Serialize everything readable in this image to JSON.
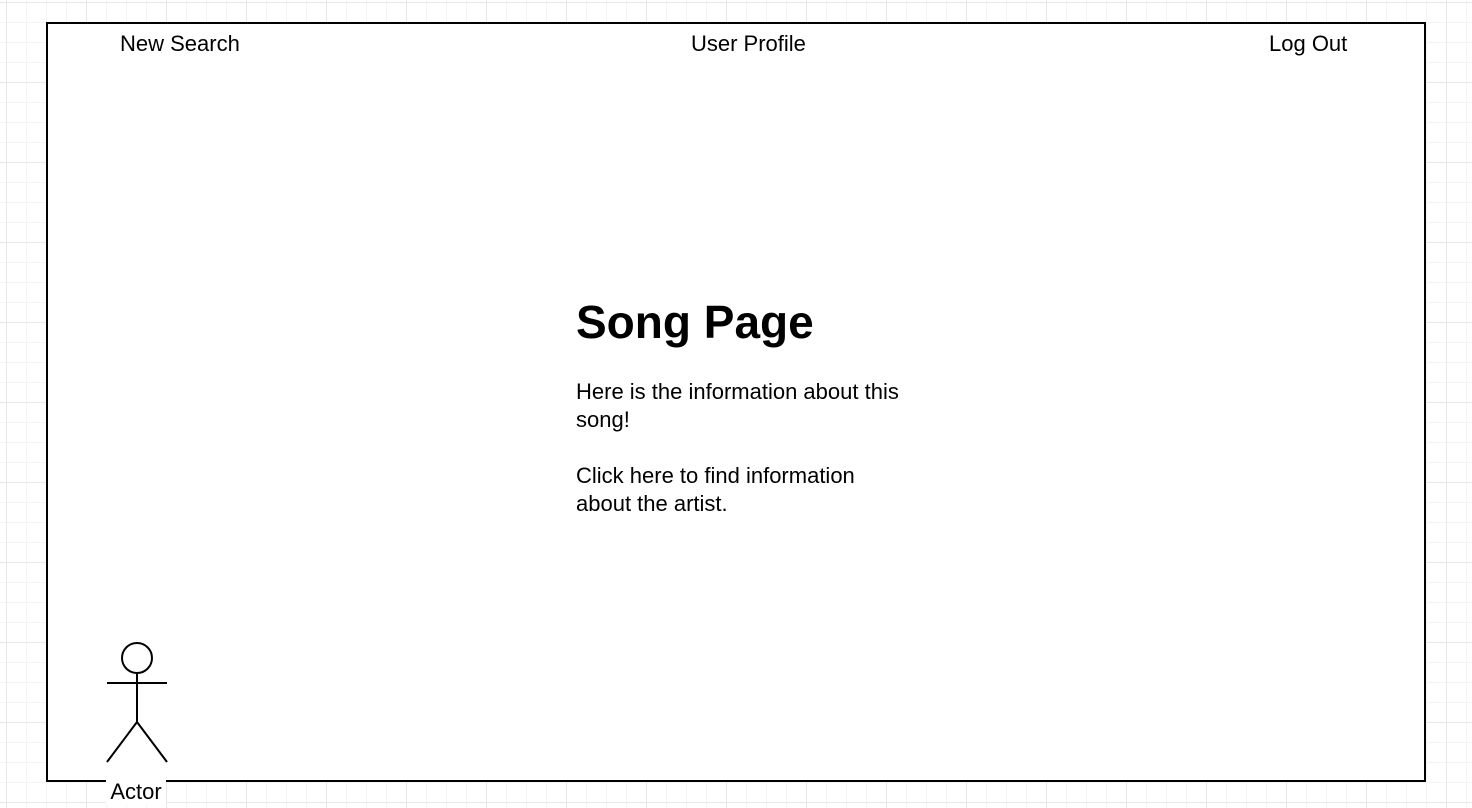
{
  "nav": {
    "new_search": "New Search",
    "user_profile": "User Profile",
    "log_out": "Log Out"
  },
  "main": {
    "title": "Song Page",
    "info": "Here is the information about this song!",
    "artist_link": "Click here to find information about the artist."
  },
  "actor": {
    "label": "Actor",
    "icon": "stick-figure-icon"
  },
  "colors": {
    "stroke": "#000000",
    "background": "#ffffff",
    "grid": "#e8e8e8"
  }
}
